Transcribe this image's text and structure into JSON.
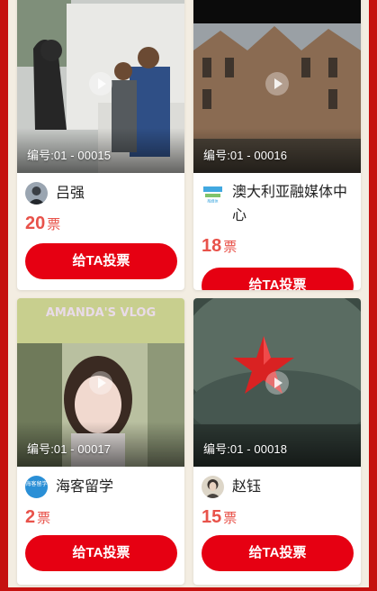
{
  "cards": [
    {
      "code": "编号:01 - 00015",
      "name": "吕强",
      "votes": "20",
      "unit": "票",
      "button": "给TA投票"
    },
    {
      "code": "编号:01 - 00016",
      "name": "澳大利亚融媒体中心",
      "votes": "18",
      "unit": "票",
      "button": "给TA投票",
      "avatar_text": "融媒体"
    },
    {
      "code": "编号:01 - 00017",
      "name": "海客留学",
      "votes": "2",
      "unit": "票",
      "button": "给TA投票",
      "avatar_text": "海客留学",
      "overlay_text": "AMANDA'S VLOG"
    },
    {
      "code": "编号:01 - 00018",
      "name": "赵钰",
      "votes": "15",
      "unit": "票",
      "button": "给TA投票"
    }
  ],
  "colors": {
    "frame": "#c5110f",
    "button": "#e60012",
    "votes": "#e8524a"
  },
  "icons": [
    "play-icon",
    "avatar"
  ]
}
